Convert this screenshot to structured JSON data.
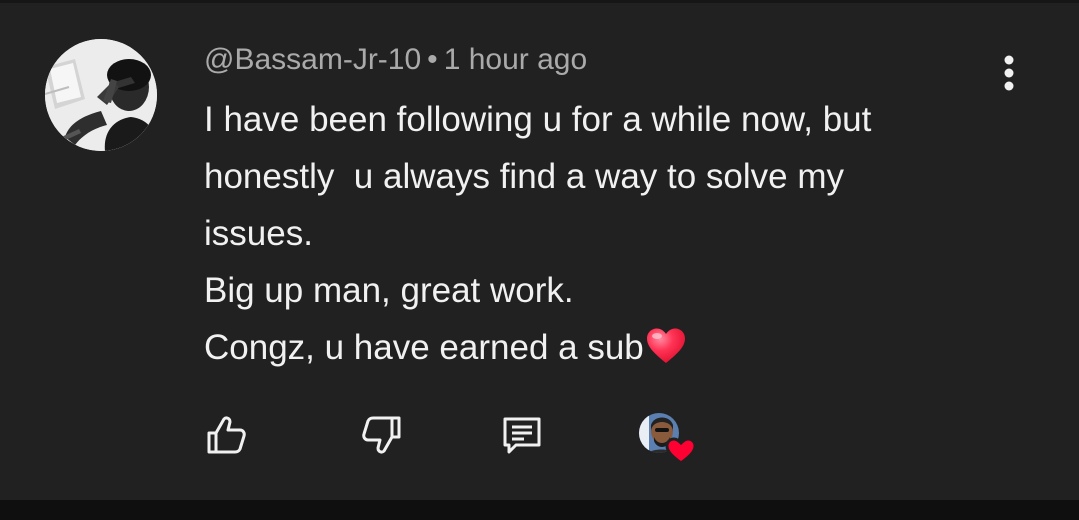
{
  "comment": {
    "author": "@Bassam-Jr-10",
    "separator": "•",
    "time": "1 hour ago",
    "lines": [
      "I have been following u for a while now, but",
      "honestly  u always find a way to solve my",
      "issues.",
      "Big up man, great work.",
      "Congz, u have earned a sub"
    ],
    "emoji": "red-heart-emoji"
  },
  "actions": {
    "like_icon": "thumb-up-icon",
    "dislike_icon": "thumb-down-icon",
    "reply_icon": "reply-comment-icon",
    "creator_heart_icon": "creator-heart-icon"
  },
  "colors": {
    "background": "#212121",
    "text": "#f1f1f1",
    "secondary_text": "#aaaaaa",
    "heart": "#ff1e3c"
  }
}
